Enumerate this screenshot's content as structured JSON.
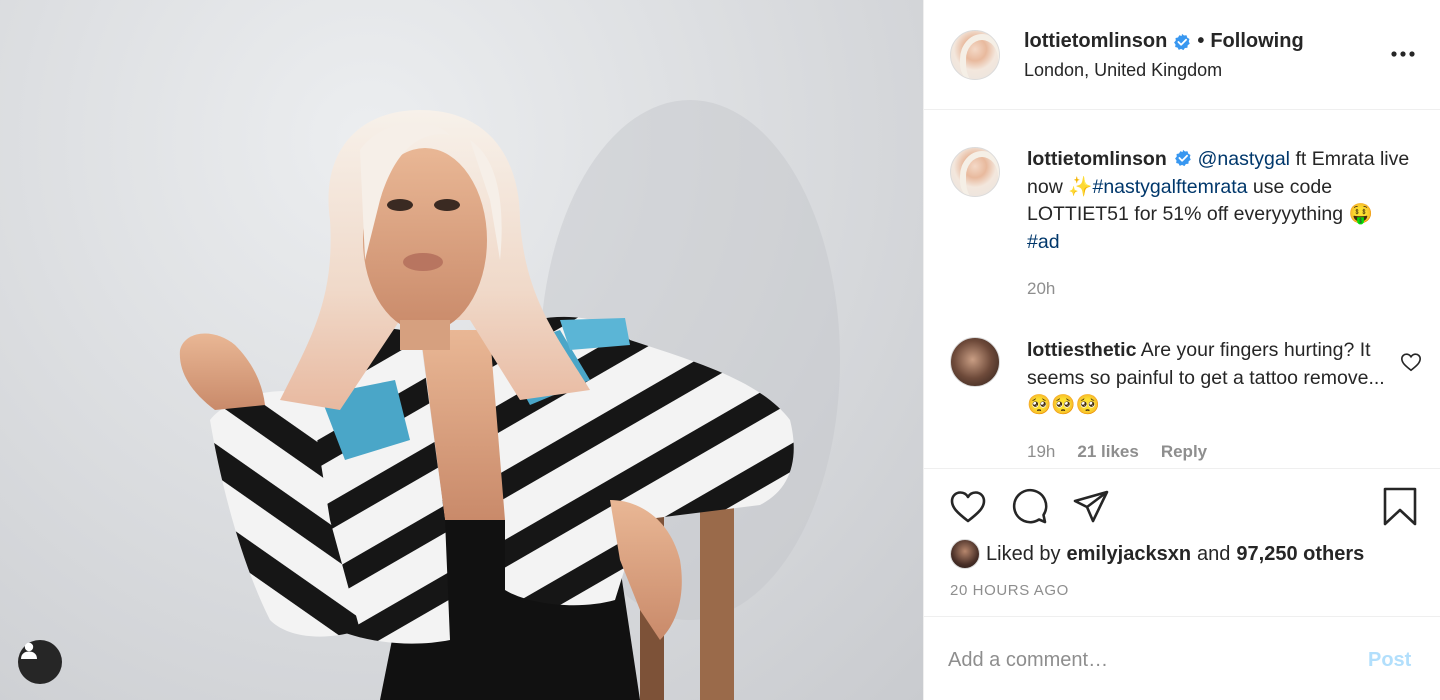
{
  "post": {
    "author": "lottietomlinson",
    "verified": true,
    "follow_dot": "•",
    "follow_status": "Following",
    "location": "London, United Kingdom"
  },
  "caption": {
    "username": "lottietomlinson",
    "mention": "@nastygal",
    "text_1": " ft Emrata live now ",
    "sparkle": "✨",
    "hashtag_1": "#nastygalftemrata",
    "text_2": " use code LOTTIET51 for 51% off everyyything ",
    "emoji": "🤑",
    "hashtag_2": "#ad",
    "time": "20h"
  },
  "comment": {
    "username": "lottiesthetic",
    "text": " Are your fingers hurting? It seems so painful to get a tattoo remove... ",
    "emoji": "🥺🥺🥺",
    "time": "19h",
    "likes": "21 likes",
    "reply": "Reply"
  },
  "likes": {
    "prefix": "Liked by",
    "liker": "emilyjacksxn",
    "and": "and",
    "others": "97,250 others"
  },
  "timestamp": "20 HOURS AGO",
  "composer": {
    "placeholder": "Add a comment…",
    "post_label": "Post"
  },
  "colors": {
    "link": "#00376b",
    "verified": "#3897f0",
    "post_disabled": "#b2dffc",
    "secondary_text": "#8e8e8e"
  },
  "icons": {
    "like": "heart-icon",
    "comment": "comment-icon",
    "share": "paper-plane-icon",
    "save": "bookmark-icon",
    "more": "more-options-icon",
    "tagged_user": "user-icon"
  }
}
